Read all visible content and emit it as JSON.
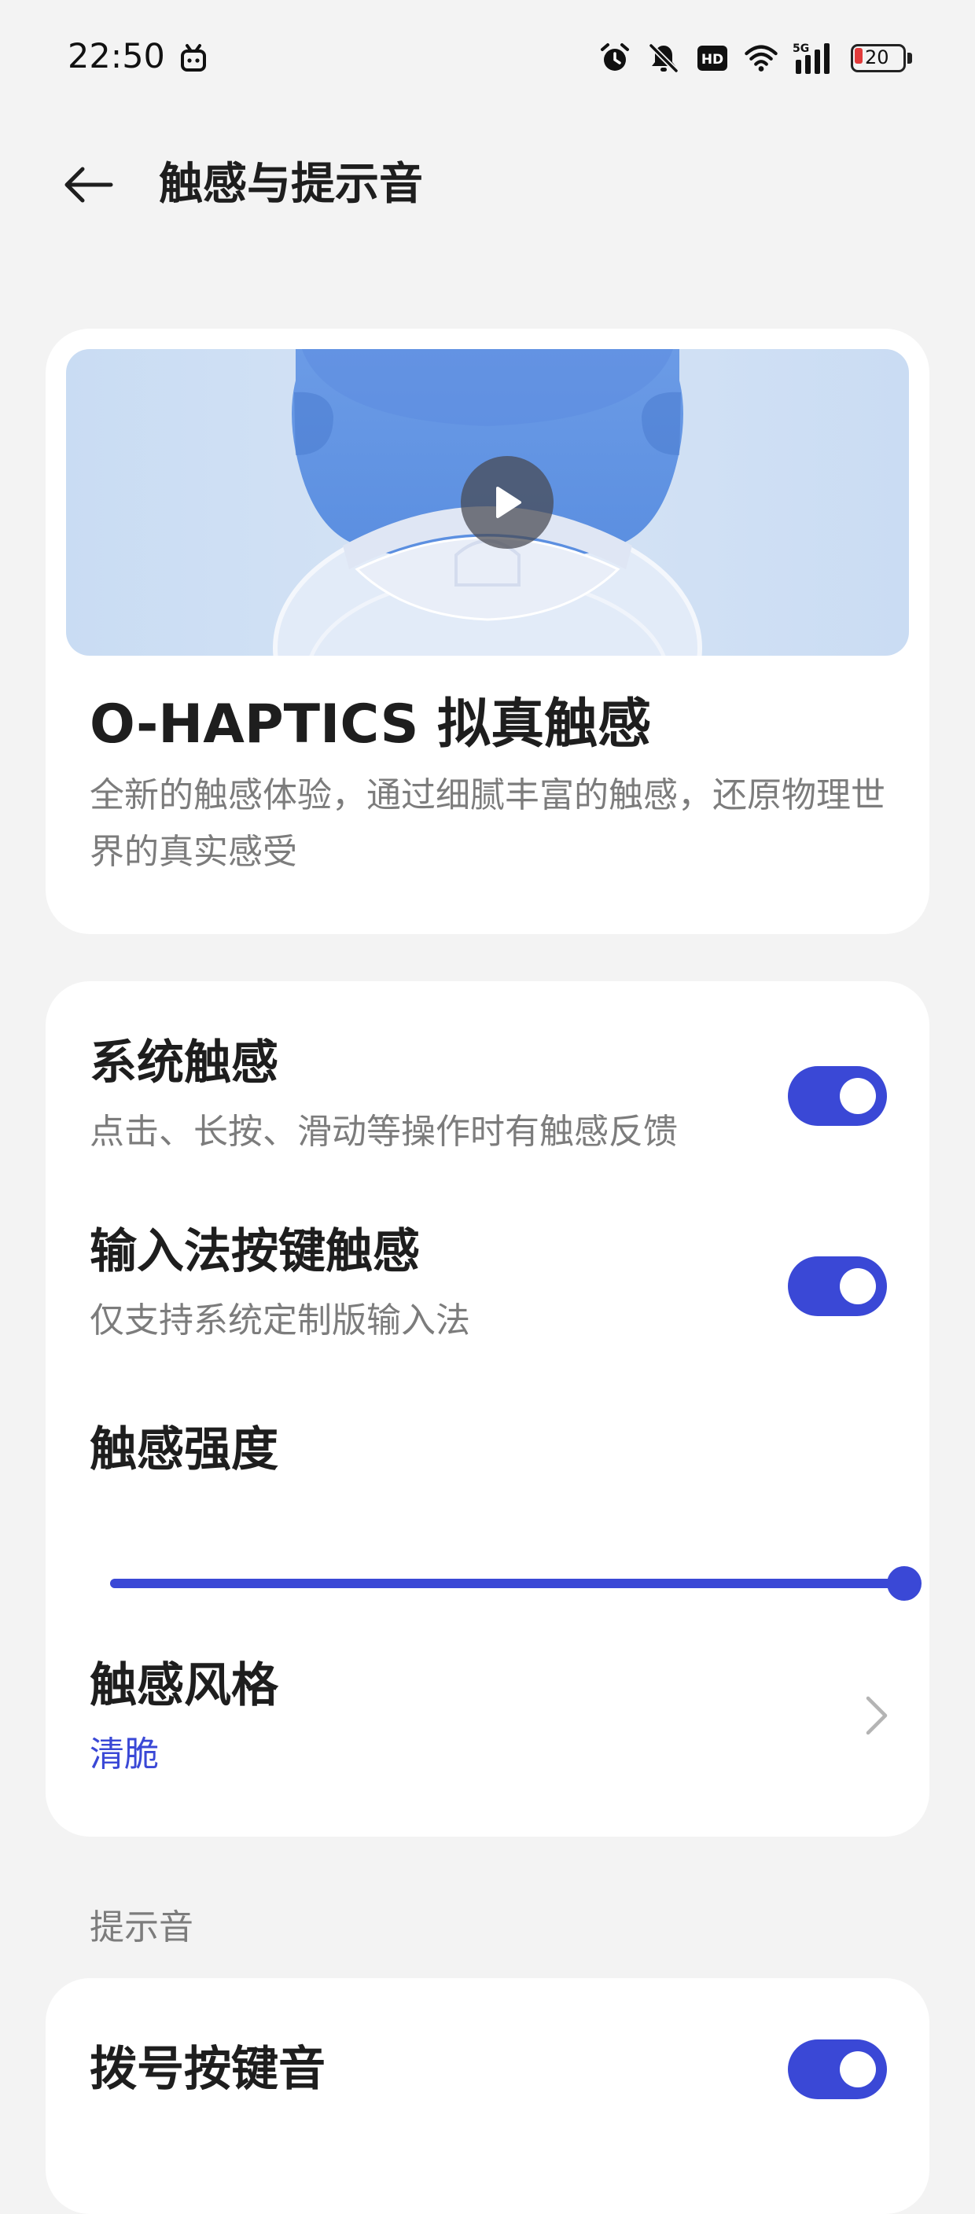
{
  "status_bar": {
    "time": "22:50",
    "battery_level": "20",
    "icons": [
      "app-notification-icon",
      "alarm-icon",
      "mute-bell-icon",
      "hd-icon",
      "wifi-icon",
      "5g-signal-icon",
      "battery-icon"
    ]
  },
  "header": {
    "title": "触感与提示音",
    "back_icon": "back-arrow-icon"
  },
  "hero": {
    "title": "O-HAPTICS 拟真触感",
    "description": "全新的触感体验，通过细腻丰富的触感，还原物理世界的真实感受",
    "play_icon": "play-icon"
  },
  "haptics": {
    "system_haptics": {
      "title": "系统触感",
      "subtitle": "点击、长按、滑动等操作时有触感反馈",
      "enabled": true
    },
    "keyboard_haptics": {
      "title": "输入法按键触感",
      "subtitle": "仅支持系统定制版输入法",
      "enabled": true
    },
    "intensity": {
      "title": "触感强度",
      "value_fraction": 1.0
    },
    "style": {
      "title": "触感风格",
      "value": "清脆"
    }
  },
  "sounds": {
    "section_label": "提示音",
    "dial_keypad_tone": {
      "title": "拨号按键音",
      "enabled": true
    }
  },
  "colors": {
    "accent": "#3a48d6",
    "background": "#f3f3f3",
    "card": "#ffffff",
    "secondary_text": "#7c7c7c"
  }
}
